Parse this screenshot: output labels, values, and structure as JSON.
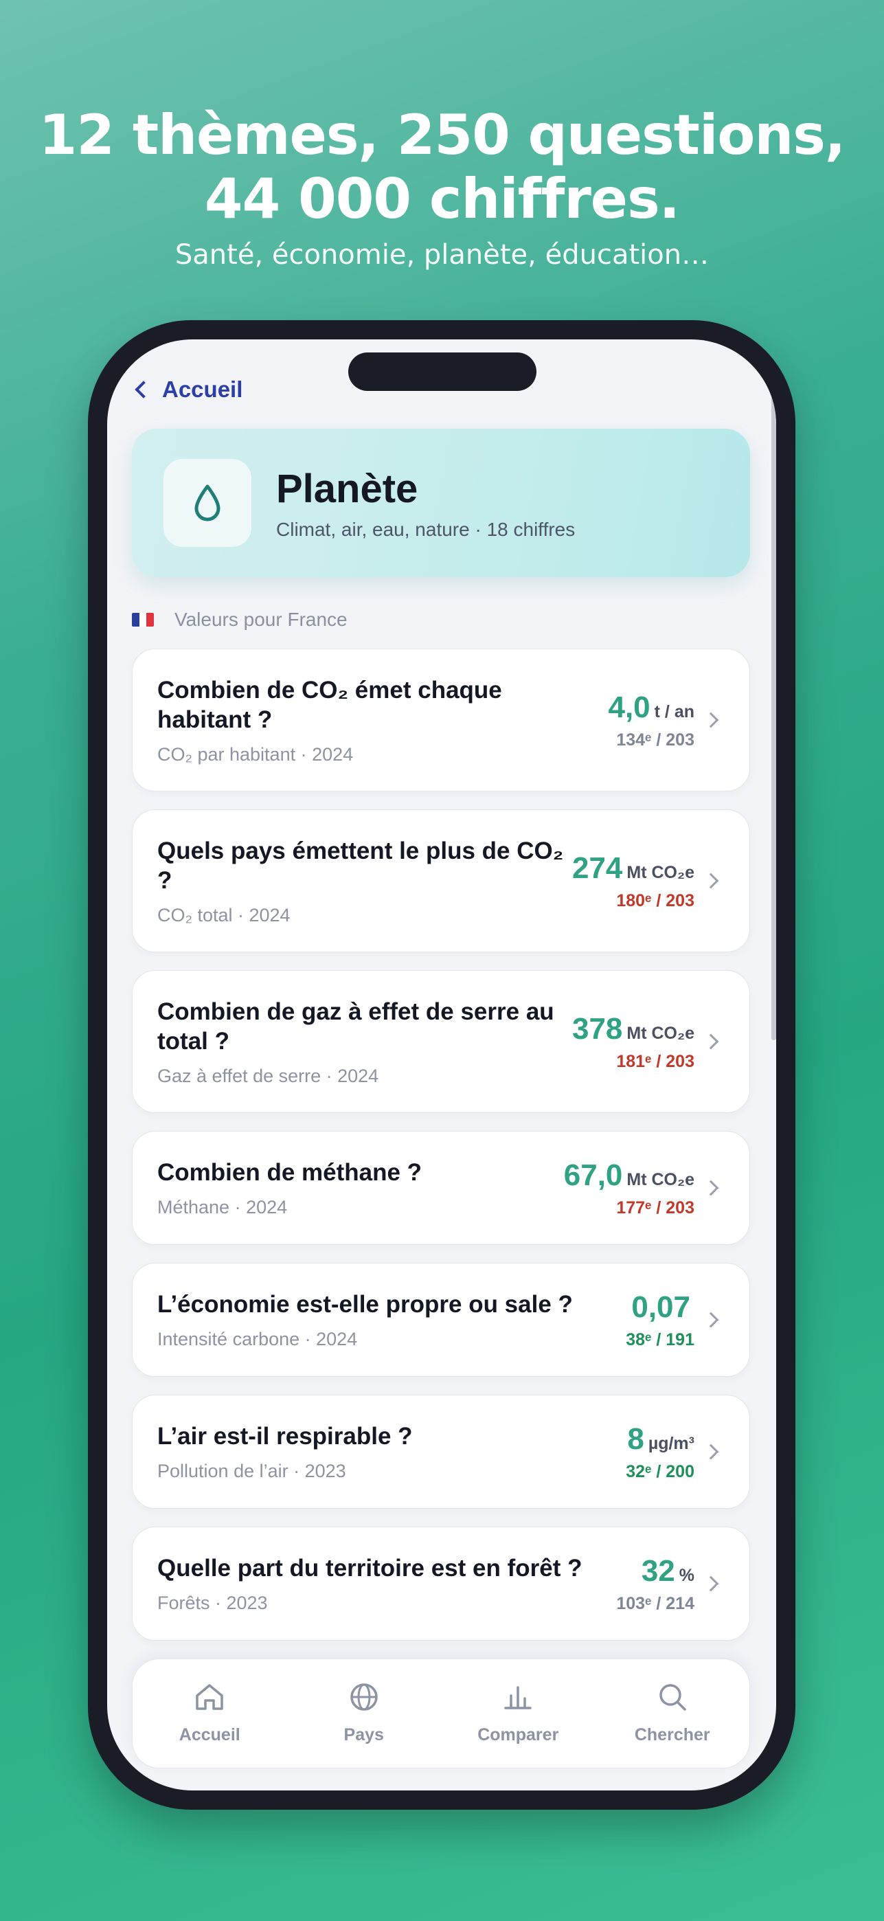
{
  "hero": {
    "title_line1": "12 thèmes, 250 questions,",
    "title_line2": "44 000 chiffres.",
    "subtitle": "Santé, économie, planète, éducation…"
  },
  "nav": {
    "back_label": "Accueil"
  },
  "theme": {
    "icon": "water-drop-icon",
    "title": "Planète",
    "subtitle": "Climat, air, eau, nature · 18 chiffres"
  },
  "country": {
    "flag": "france-flag-icon",
    "label": "Valeurs pour France"
  },
  "colors": {
    "value_green": "#2ea283",
    "rank_red": "#c0392b",
    "rank_green": "#1f8f5c",
    "rank_gray": "#7f8594"
  },
  "questions": [
    {
      "question": "Combien de CO₂ émet chaque habitant ?",
      "meta": "CO₂ par habitant · 2024",
      "value": "4,0",
      "unit": "t / an",
      "rank": "134ᵉ / 203",
      "rank_color": "gray"
    },
    {
      "question": "Quels pays émettent le plus de CO₂ ?",
      "meta": "CO₂ total · 2024",
      "value": "274",
      "unit": "Mt CO₂e",
      "rank": "180ᵉ / 203",
      "rank_color": "red"
    },
    {
      "question": "Combien de gaz à effet de serre au total ?",
      "meta": "Gaz à effet de serre · 2024",
      "value": "378",
      "unit": "Mt CO₂e",
      "rank": "181ᵉ / 203",
      "rank_color": "red"
    },
    {
      "question": "Combien de méthane ?",
      "meta": "Méthane · 2024",
      "value": "67,0",
      "unit": "Mt CO₂e",
      "rank": "177ᵉ / 203",
      "rank_color": "red"
    },
    {
      "question": "L’économie est-elle propre ou sale ?",
      "meta": "Intensité carbone · 2024",
      "value": "0,07",
      "unit": "",
      "rank": "38ᵉ / 191",
      "rank_color": "green"
    },
    {
      "question": "L’air est-il respirable ?",
      "meta": "Pollution de l’air · 2023",
      "value": "8",
      "unit": "µg/m³",
      "rank": "32ᵉ / 200",
      "rank_color": "green"
    },
    {
      "question": "Quelle part du territoire est en forêt ?",
      "meta": "Forêts · 2023",
      "value": "32",
      "unit": "%",
      "rank": "103ᵉ / 214",
      "rank_color": "gray"
    }
  ],
  "tabbar": [
    {
      "label": "Accueil",
      "icon": "home-icon"
    },
    {
      "label": "Pays",
      "icon": "globe-icon"
    },
    {
      "label": "Comparer",
      "icon": "bar-chart-icon"
    },
    {
      "label": "Chercher",
      "icon": "search-icon"
    }
  ]
}
